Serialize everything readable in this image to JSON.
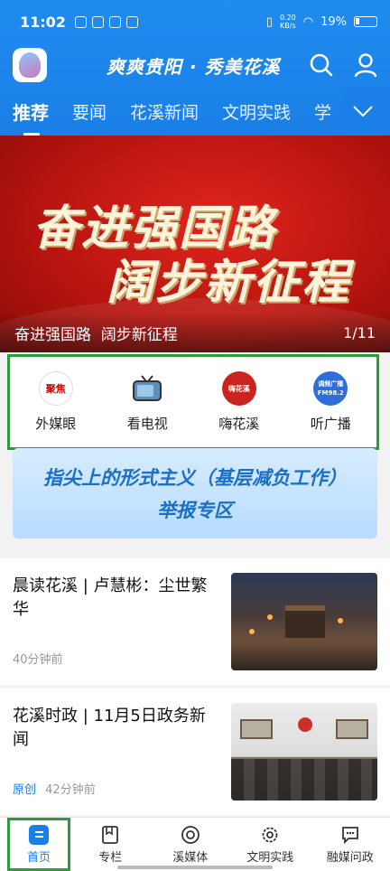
{
  "status": {
    "time": "11:02",
    "net_speed": "0.20\nKB/s",
    "battery": "19%"
  },
  "topbar": {
    "slogan": "爽爽贵阳 · 秀美花溪"
  },
  "tabs": [
    {
      "label": "推荐",
      "active": true
    },
    {
      "label": "要闻"
    },
    {
      "label": "花溪新闻"
    },
    {
      "label": "文明实践"
    },
    {
      "label": "学"
    }
  ],
  "banner": {
    "line1": "奋进强国路",
    "line2": "阔步新征程",
    "caption": "奋进强国路  阔步新征程",
    "counter": "1/11"
  },
  "quick_links": [
    {
      "label": "外媒眼",
      "icon": "聚焦"
    },
    {
      "label": "看电视",
      "icon": "tv-icon"
    },
    {
      "label": "嗨花溪",
      "icon": "嗨花溪"
    },
    {
      "label": "听广播",
      "icon": "调频广播 FM98.2"
    }
  ],
  "promo": {
    "line1": "指尖上的形式主义（基层减负工作）",
    "line2": "举报专区"
  },
  "news": [
    {
      "title": "晨读花溪 | 卢慧彬：尘世繁华",
      "time": "40分钟前",
      "tag": ""
    },
    {
      "title": "花溪时政 | 11月5日政务新闻",
      "time": "42分钟前",
      "tag": "原创"
    }
  ],
  "nav": [
    {
      "label": "首页",
      "active": true
    },
    {
      "label": "专栏"
    },
    {
      "label": "溪媒体"
    },
    {
      "label": "文明实践"
    },
    {
      "label": "融媒问政"
    }
  ],
  "colors": {
    "primary": "#1a7fe6",
    "highlight_box": "#2a9d3a",
    "banner_red": "#c91a14"
  }
}
